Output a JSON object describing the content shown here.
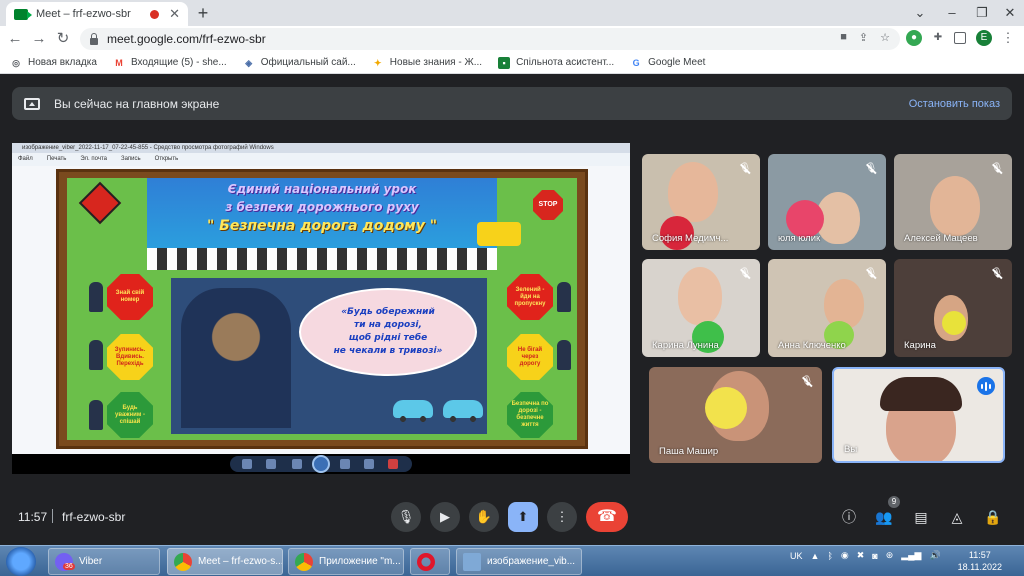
{
  "browser": {
    "tab_title": "Meet – frf-ezwo-sbr",
    "url": "meet.google.com/frf-ezwo-sbr",
    "profile_initial": "E",
    "bookmarks": [
      {
        "label": "Новая вкладка",
        "icon": "globe-icon"
      },
      {
        "label": "Входящие (5) - she...",
        "icon": "gmail-icon"
      },
      {
        "label": "Официальный сай...",
        "icon": "site-icon"
      },
      {
        "label": "Новые знания - Ж...",
        "icon": "star-icon"
      },
      {
        "label": "Спільнота асистент...",
        "icon": "classroom-icon"
      },
      {
        "label": "Google Meet",
        "icon": "google-icon"
      }
    ]
  },
  "presentation_bar": {
    "text": "Вы сейчас на главном экране",
    "stop_label": "Остановить показ"
  },
  "shared_screen": {
    "viewer_title": "изображение_viber_2022-11-17_07-22-45-855 - Средство просмотра фотографий Windows",
    "menu": [
      "Файл",
      "Печать",
      "Эл. почта",
      "Запись",
      "Открыть"
    ],
    "poster": {
      "line1": "Єдиний національний урок",
      "line2": "з безпеки дорожнього руху",
      "line3": "\" Безпечна дорога додому \"",
      "bubble": [
        "«Будь обережний",
        "ти на дорозі,",
        "щоб рідні тебе",
        "не чекали в тривозі»"
      ],
      "stop": "STOP",
      "signs_left": [
        "Знай свій номер",
        "Зупинись. Вдивись. Перехідь",
        "Будь уважним - спішай"
      ],
      "signs_right": [
        "Зелений - йди на пропускну",
        "Не бігай через дорогу",
        "Безпечна по дорозі - безпечне життя"
      ]
    }
  },
  "participants": [
    {
      "name": "София Медимч...",
      "muted": true
    },
    {
      "name": "юля юлик",
      "muted": true
    },
    {
      "name": "Алексей Мацеев",
      "muted": true
    },
    {
      "name": "Карина Лунина",
      "muted": true
    },
    {
      "name": "Анна Ключенко",
      "muted": true
    },
    {
      "name": "Карина",
      "muted": true
    },
    {
      "name": "Паша Машир",
      "muted": true
    },
    {
      "name": "Вы",
      "muted": false,
      "speaking": true
    }
  ],
  "meeting": {
    "time": "11:57",
    "code": "frf-ezwo-sbr",
    "participant_count": "9"
  },
  "taskbar": {
    "items": [
      "Viber",
      "Meet – frf-ezwo-s...",
      "Приложение \"m...",
      "",
      "изображение_vib..."
    ],
    "viber_badge": "36",
    "lang": "UK",
    "time": "11:57",
    "date": "18.11.2022"
  },
  "colors": {
    "meet_bg": "#202124",
    "end_call": "#ea4335",
    "accent_blue": "#8ab4f8",
    "speaking_blue": "#1a73e8"
  }
}
